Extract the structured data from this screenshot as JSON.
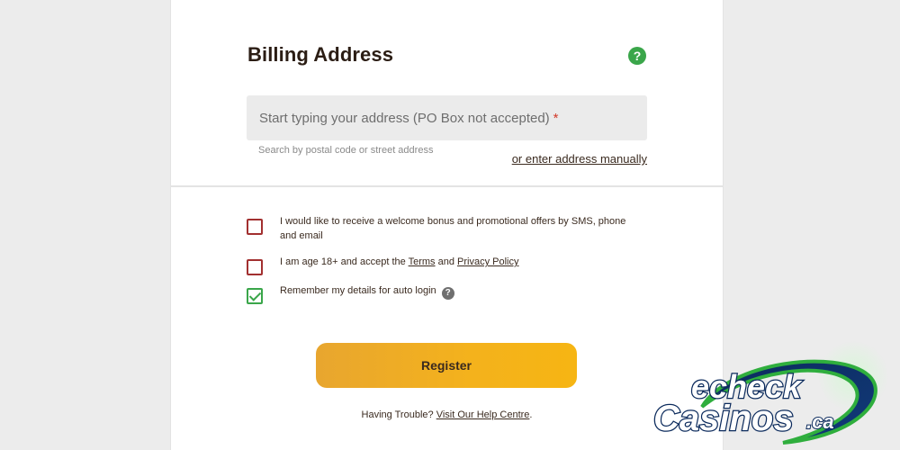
{
  "billing": {
    "title": "Billing Address",
    "help_icon": "question-icon",
    "address_placeholder": "Start typing your address (PO Box not accepted)",
    "required_marker": "*",
    "hint": "Search by postal code or street address",
    "manual_link": "or enter address manually"
  },
  "options": {
    "marketing": {
      "checked": false,
      "text": "I would like to receive a welcome bonus and promotional offers by SMS, phone and email"
    },
    "age": {
      "checked": false,
      "prefix": "I am age 18+ and accept the ",
      "terms_link": "Terms",
      "and": " and ",
      "privacy_link": "Privacy Policy"
    },
    "remember": {
      "checked": true,
      "text": "Remember my details for auto login",
      "info_icon": "question-icon"
    }
  },
  "register": {
    "label": "Register"
  },
  "trouble": {
    "prefix": "Having Trouble? ",
    "link": "Visit Our Help Centre",
    "suffix": "."
  },
  "watermark": {
    "line1": "echeck",
    "line2": "Casinos",
    "suffix": ".ca"
  },
  "colors": {
    "accent_green": "#3aa64a",
    "checkbox_red": "#a23030",
    "button_yellow": "#f4b21c"
  }
}
